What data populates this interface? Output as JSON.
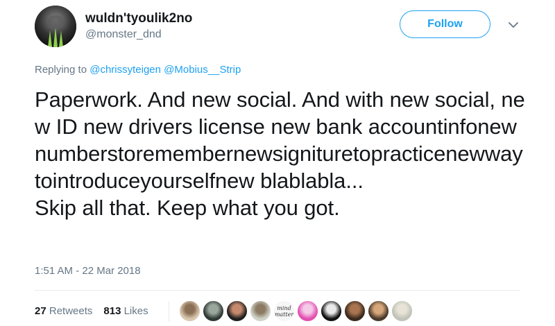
{
  "author": {
    "display_name": "wuldn'tyoulik2no",
    "screen_name": "@monster_dnd",
    "avatar_icon": "monster-energy-claw-logo"
  },
  "follow_label": "Follow",
  "caret_icon": "chevron-down-icon",
  "replying": {
    "prefix": "Replying to",
    "mentions": [
      "@chrissyteigen",
      "@Mobius__Strip"
    ]
  },
  "tweet_text": "Paperwork. And new social. And with new social, new ID new drivers license new bank accountinfonewnumberstoremembernewsignituretopracticenewwaytointroduceyourselfnew blablabla...\nSkip all that. Keep what you got.",
  "timestamp": "1:51 AM - 22 Mar 2018",
  "stats": {
    "retweets_count": "27",
    "retweets_label": "Retweets",
    "likes_count": "813",
    "likes_label": "Likes"
  },
  "likers": [
    {
      "name": "liker-1-avatar",
      "colors": [
        "#d9c7b0",
        "#8a6f55"
      ]
    },
    {
      "name": "liker-2-avatar",
      "colors": [
        "#2f3a35",
        "#9aa79c"
      ]
    },
    {
      "name": "liker-3-avatar",
      "colors": [
        "#1f1f1f",
        "#c58a6e"
      ]
    },
    {
      "name": "liker-4-avatar",
      "colors": [
        "#cfd3c8",
        "#8c7a63"
      ]
    },
    {
      "name": "liker-5-avatar",
      "text": [
        "mind",
        "matter"
      ]
    },
    {
      "name": "liker-6-avatar",
      "colors": [
        "#e34fb0",
        "#f5c9e8"
      ]
    },
    {
      "name": "liker-7-avatar",
      "colors": [
        "#111111",
        "#e9e9e9"
      ]
    },
    {
      "name": "liker-8-avatar",
      "colors": [
        "#3a2a1e",
        "#a9744f"
      ]
    },
    {
      "name": "liker-9-avatar",
      "colors": [
        "#4a3a2c",
        "#d6a77a"
      ]
    },
    {
      "name": "liker-10-avatar",
      "colors": [
        "#bfc3b9",
        "#e8e3d6"
      ]
    }
  ],
  "colors": {
    "accent": "#1da1f2",
    "secondary_text": "#657786",
    "primary_text": "#14171a"
  }
}
